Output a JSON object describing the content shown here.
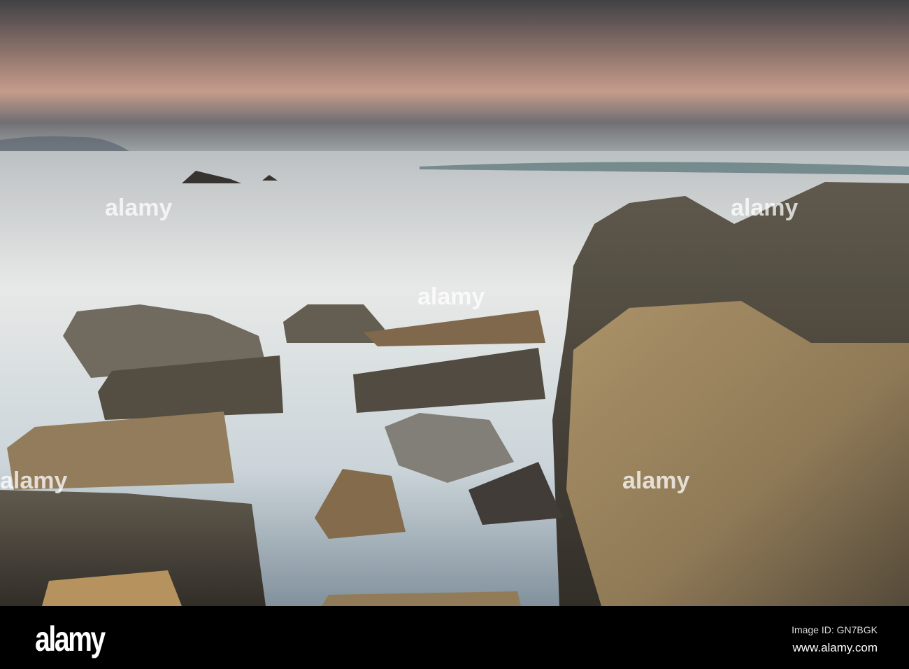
{
  "footer": {
    "logo": "alamy",
    "image_id": "Image ID: GN7BGK",
    "website": "www.alamy.com"
  },
  "watermark": "alamy",
  "colors": {
    "sky_top": "#3b3d42",
    "sky_glow": "#c99a83",
    "sea": "#dfe4e5",
    "rock": "#8a7450"
  }
}
